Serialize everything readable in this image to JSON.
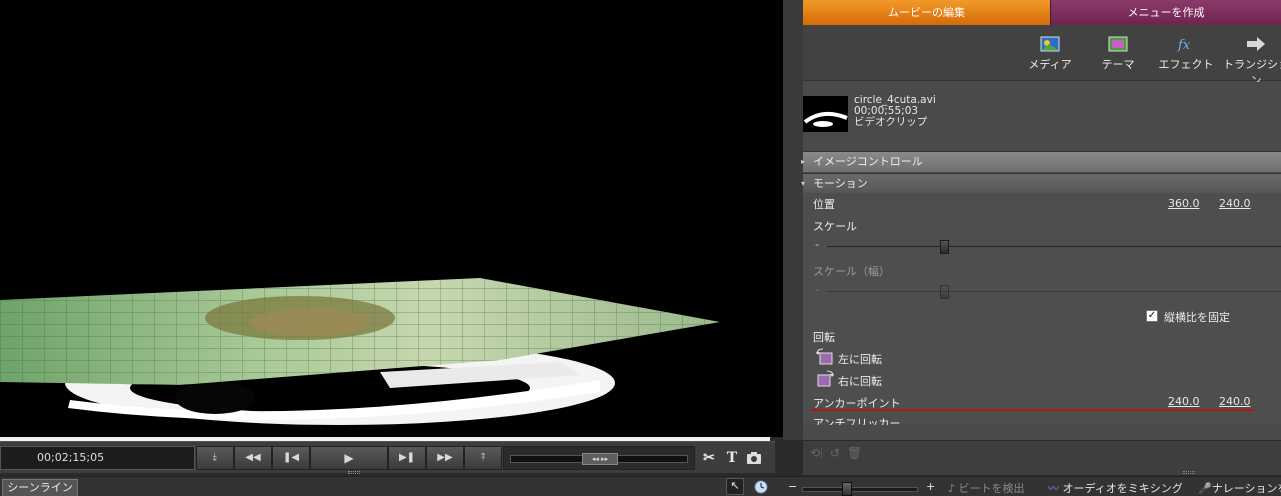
{
  "tabs": {
    "edit_movie": "ムービーの編集",
    "create_menu": "メニューを作成"
  },
  "toolbar": {
    "media": "メディア",
    "theme": "テーマ",
    "effect": "エフェクト",
    "transition": "トランジション"
  },
  "clip": {
    "filename": "circle_4cuta.avi",
    "duration": "00;00;55;03",
    "type": "ビデオクリップ"
  },
  "sections": {
    "image_control": "イメージコントロール",
    "motion": "モーション"
  },
  "motion": {
    "position_label": "位置",
    "position_x": "360.0",
    "position_y": "240.0",
    "scale_label": "スケール",
    "scale_width_label": "スケール（幅）",
    "lock_aspect_label": "縦横比を固定",
    "lock_aspect_checked": true,
    "rotation_label": "回転",
    "rotate_left": "左に回転",
    "rotate_right": "右に回転",
    "anchor_label": "アンカーポイント",
    "anchor_x": "240.0",
    "anchor_y": "240.0",
    "next_label": "アンチフリッカー"
  },
  "transport": {
    "timecode": "00;02;15;05",
    "jog_label": "◂◂ ▸▸"
  },
  "bottombar": {
    "scene_line": "シーンライン",
    "zoom_minus": "−",
    "zoom_plus": "+",
    "detect_beat": "ビートを検出",
    "audio_mixing": "オーディオをミキシング",
    "narration": "ナレーションを"
  },
  "colors": {
    "tab_edit": "#e37e14",
    "tab_menu": "#7a2c5c",
    "panel_bg": "#4a4a4a",
    "anchor_underline": "#b01818"
  }
}
